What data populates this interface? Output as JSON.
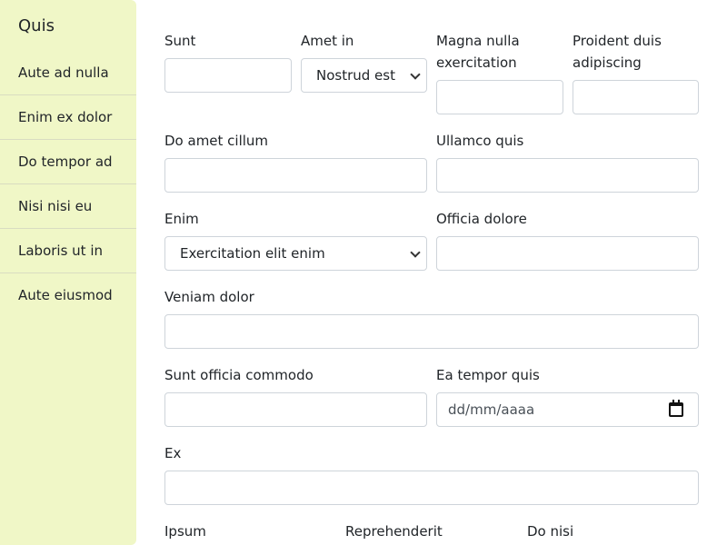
{
  "sidebar": {
    "title": "Quis",
    "items": [
      "Aute ad nulla",
      "Enim ex dolor",
      "Do tempor ad",
      "Nisi nisi eu",
      "Laboris ut in",
      "Aute eiusmod"
    ]
  },
  "form": {
    "sunt": {
      "label": "Sunt",
      "value": ""
    },
    "amet_in": {
      "label": "Amet in",
      "selected": "Nostrud est"
    },
    "magna": {
      "label_line1": "Magna nulla",
      "label_line2": "exercitation",
      "value": ""
    },
    "proident": {
      "label_line1": "Proident duis",
      "label_line2": "adipiscing",
      "value": ""
    },
    "do_amet": {
      "label": "Do amet cillum",
      "value": ""
    },
    "ullamco": {
      "label": "Ullamco quis",
      "value": ""
    },
    "enim": {
      "label": "Enim",
      "selected": "Exercitation elit enim"
    },
    "officia": {
      "label": "Officia dolore",
      "value": ""
    },
    "veniam": {
      "label": "Veniam dolor",
      "value": ""
    },
    "sunt_officia": {
      "label": "Sunt officia commodo",
      "value": ""
    },
    "ea_tempor": {
      "label": "Ea tempor quis",
      "placeholder": "dd/mm/aaaa"
    },
    "ex": {
      "label": "Ex",
      "value": ""
    },
    "ipsum": {
      "label": "Ipsum"
    },
    "reprehenderit": {
      "label": "Reprehenderit"
    },
    "do_nisi": {
      "label": "Do nisi"
    }
  }
}
